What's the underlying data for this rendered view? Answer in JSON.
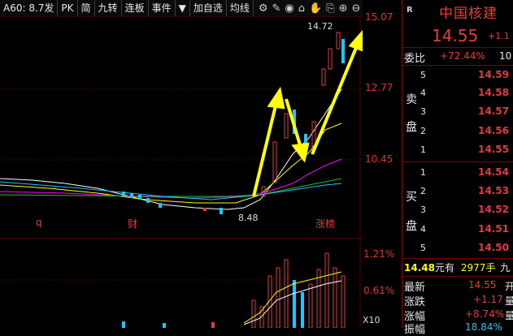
{
  "toolbar": {
    "items": [
      "A60: 8.7发",
      "PK",
      "简",
      "九转",
      "连板",
      "事件",
      "▼",
      "加自选",
      "均线"
    ],
    "icons": [
      "settings-icon",
      "draw-icon",
      "eye-icon",
      "lock-icon",
      "hand-icon",
      "copy-icon",
      "zoom-in-icon",
      "zoom-out-icon"
    ]
  },
  "chart": {
    "price_axis": [
      "15.07",
      "12.77",
      "10.45"
    ],
    "high_label": "14.72",
    "low_label": "8.48",
    "markers": [
      "q",
      "财",
      "涨榜"
    ],
    "volume_axis": [
      "1.21%",
      "0.61%"
    ],
    "x10": "X10"
  },
  "panel": {
    "badge": "R",
    "name": "中国核建",
    "price": "14.55",
    "change": "+1.1",
    "weibi_label": "委比",
    "weibi_value": "+72.44%",
    "weibi_extra": "10",
    "sell_label_1": "卖",
    "sell_label_2": "盘",
    "buy_label_1": "买",
    "buy_label_2": "盘",
    "sells": [
      {
        "lvl": "5",
        "price": "14.59"
      },
      {
        "lvl": "4",
        "price": "14.58"
      },
      {
        "lvl": "3",
        "price": "14.57"
      },
      {
        "lvl": "2",
        "price": "14.56"
      },
      {
        "lvl": "1",
        "price": "14.55"
      }
    ],
    "buys": [
      {
        "lvl": "1",
        "price": "14.54"
      },
      {
        "lvl": "2",
        "price": "14.53"
      },
      {
        "lvl": "3",
        "price": "14.52"
      },
      {
        "lvl": "4",
        "price": "14.51"
      },
      {
        "lvl": "5",
        "price": "14.50"
      }
    ],
    "have_price": "14.48",
    "have_text": "元有",
    "have_qty": "2977手",
    "have_suffix": "九",
    "quote_labels": [
      "最新",
      "涨跌",
      "涨幅",
      "振幅"
    ],
    "quote_values": [
      "14.55",
      "+1.17",
      "+8.74%",
      "18.84%"
    ],
    "quote_suffix": [
      "开",
      "量",
      "量",
      "量"
    ]
  },
  "colors": {
    "up": "#e23b3b",
    "down": "#19c8ff",
    "accent": "#ffff00"
  }
}
